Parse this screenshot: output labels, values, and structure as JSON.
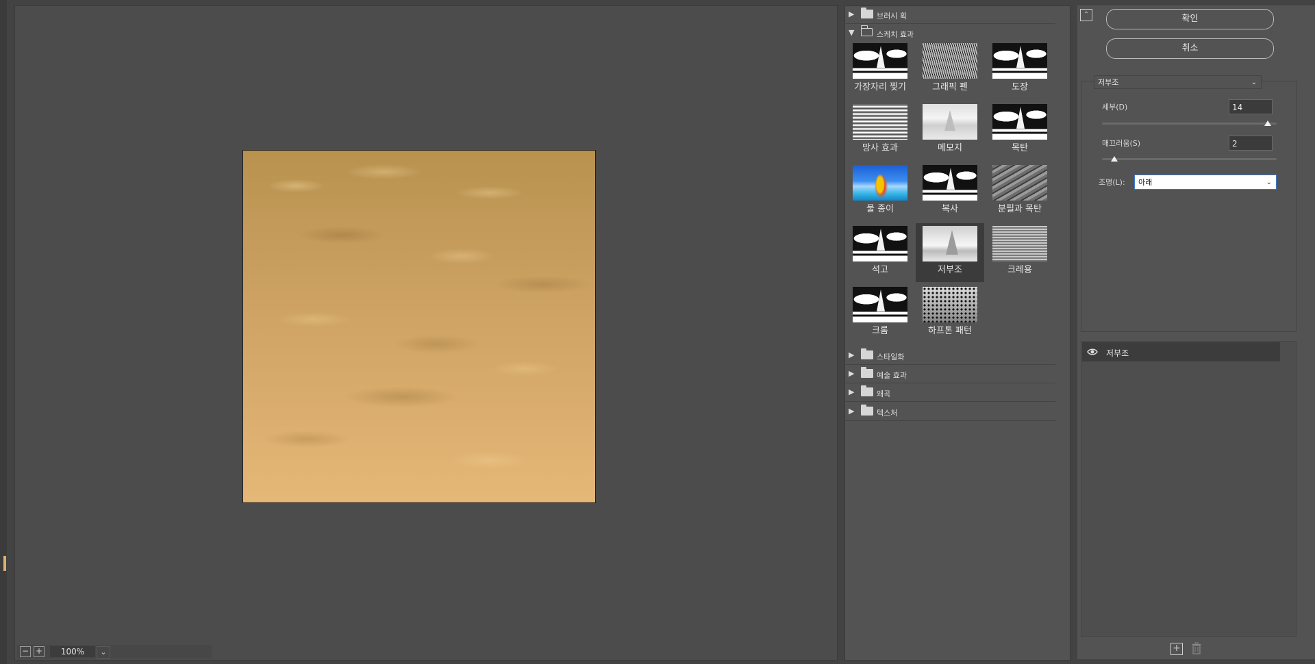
{
  "preview": {
    "zoom_value": "100%",
    "zoom_minus": "−",
    "zoom_plus": "+",
    "zoom_caret": "⌄"
  },
  "gallery": {
    "categories_top": [
      {
        "label": "브러시 획",
        "expanded": false
      },
      {
        "label": "스케치 효과",
        "expanded": true
      }
    ],
    "sketch_filters": [
      {
        "label": "가장자리 찢기",
        "style": "t-bw",
        "selected": false
      },
      {
        "label": "그래픽 펜",
        "style": "t-graphic",
        "selected": false
      },
      {
        "label": "도장",
        "style": "t-bw",
        "selected": false
      },
      {
        "label": "망사 효과",
        "style": "t-noise",
        "selected": false
      },
      {
        "label": "메모지",
        "style": "t-memo",
        "selected": false
      },
      {
        "label": "목탄",
        "style": "t-bw",
        "selected": false
      },
      {
        "label": "물 종이",
        "style": "t-water",
        "selected": false
      },
      {
        "label": "복사",
        "style": "t-bw",
        "selected": false
      },
      {
        "label": "분필과 목탄",
        "style": "t-chalk",
        "selected": false
      },
      {
        "label": "석고",
        "style": "t-bw",
        "selected": false
      },
      {
        "label": "저부조",
        "style": "t-relief",
        "selected": true
      },
      {
        "label": "크레용",
        "style": "t-conte",
        "selected": false
      },
      {
        "label": "크롬",
        "style": "t-bw",
        "selected": false
      },
      {
        "label": "하프톤 패턴",
        "style": "t-halftone",
        "selected": false
      }
    ],
    "categories_bottom": [
      {
        "label": "스타일화"
      },
      {
        "label": "예술 효과"
      },
      {
        "label": "왜곡"
      },
      {
        "label": "텍스처"
      }
    ]
  },
  "settings": {
    "ok_label": "확인",
    "cancel_label": "취소",
    "filter_select": "저부조",
    "detail_label": "세부(D)",
    "detail_value": "14",
    "detail_fraction": 1.0,
    "smoothness_label": "매끄러움(S)",
    "smoothness_value": "2",
    "smoothness_fraction": 0.1,
    "light_label": "조명(L):",
    "light_value": "아래"
  },
  "layers": {
    "items": [
      {
        "label": "저부조",
        "visible": true
      }
    ]
  }
}
